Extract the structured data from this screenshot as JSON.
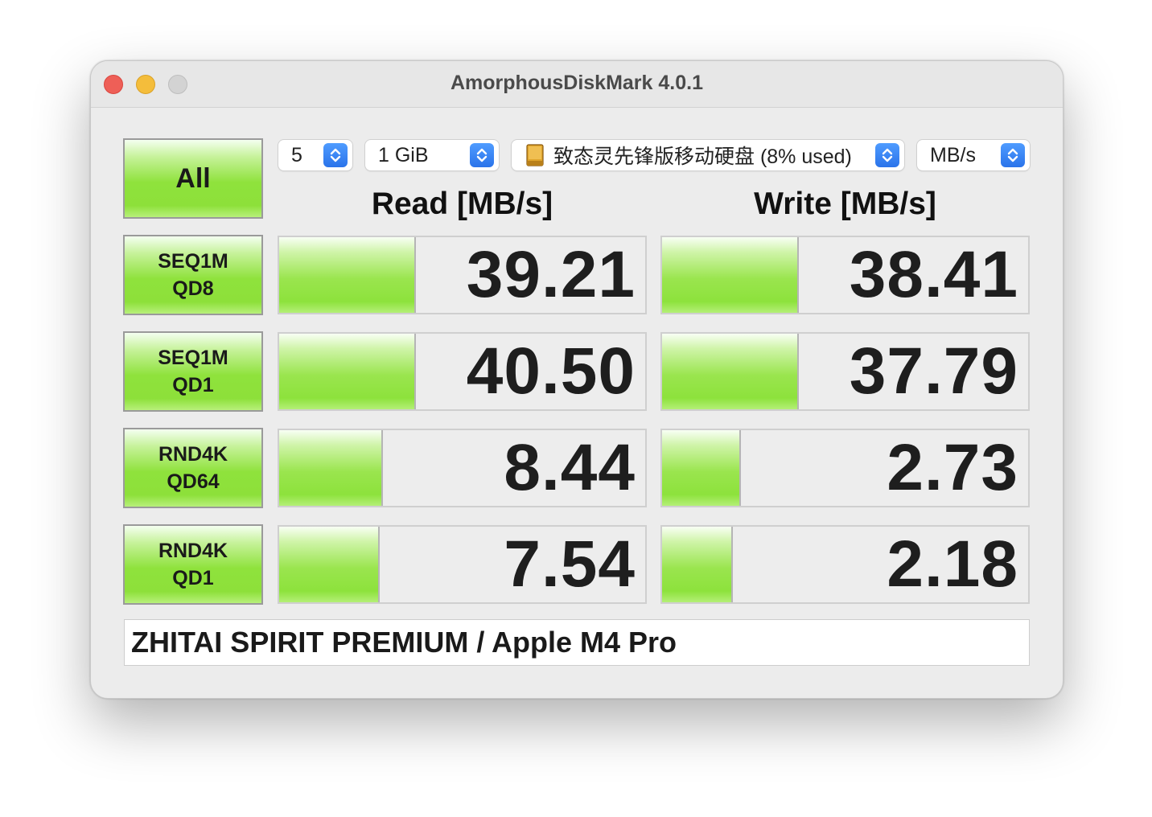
{
  "window": {
    "title": "AmorphousDiskMark 4.0.1"
  },
  "controls": {
    "count": "5",
    "size": "1 GiB",
    "drive": "致态灵先锋版移动硬盘 (8% used)",
    "unit": "MB/s"
  },
  "all_button": "All",
  "headers": {
    "read": "Read [MB/s]",
    "write": "Write [MB/s]"
  },
  "tests": [
    {
      "line1": "SEQ1M",
      "line2": "QD8",
      "read": "39.21",
      "write": "38.41",
      "read_fill": 0.37,
      "write_fill": 0.37
    },
    {
      "line1": "SEQ1M",
      "line2": "QD1",
      "read": "40.50",
      "write": "37.79",
      "read_fill": 0.37,
      "write_fill": 0.37
    },
    {
      "line1": "RND4K",
      "line2": "QD64",
      "read": "8.44",
      "write": "2.73",
      "read_fill": 0.28,
      "write_fill": 0.21
    },
    {
      "line1": "RND4K",
      "line2": "QD1",
      "read": "7.54",
      "write": "2.18",
      "read_fill": 0.27,
      "write_fill": 0.19
    }
  ],
  "comment": "ZHITAI SPIRIT PREMIUM / Apple M4 Pro",
  "icons": {
    "stepper": "updown-chevron-icon",
    "drive": "external-drive-icon"
  },
  "colors": {
    "accent": "#2a73ea",
    "bar_green": "#8de23c"
  }
}
